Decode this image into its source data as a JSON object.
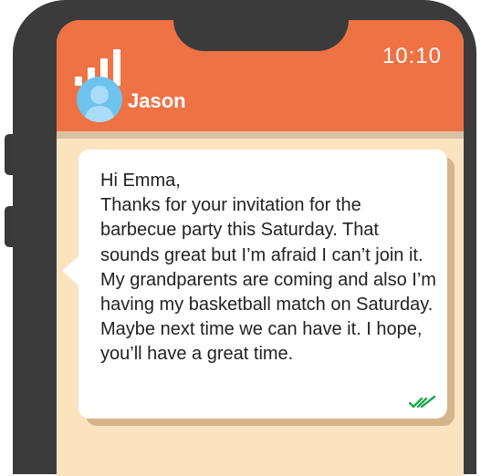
{
  "status_bar": {
    "time": "10:10",
    "signal_bars": 4
  },
  "chat_header": {
    "contact_name": "Jason",
    "avatar_icon": "user-avatar-icon"
  },
  "message": {
    "text": "Hi Emma,\nThanks for your invitation for the barbecue party this Saturday. That sounds great but I’m afraid I can’t join it. My grandparents are coming and also I’m having my basketball match on Saturday. Maybe next time we can have it. I hope, you’ll have a great time.",
    "status_icon": "double-check-icon"
  },
  "colors": {
    "header": "#ef7244",
    "screen": "#fce3c0",
    "phone": "#3b3b3b",
    "avatar": "#6ec3ee",
    "read_ticks": "#1fa84f"
  }
}
